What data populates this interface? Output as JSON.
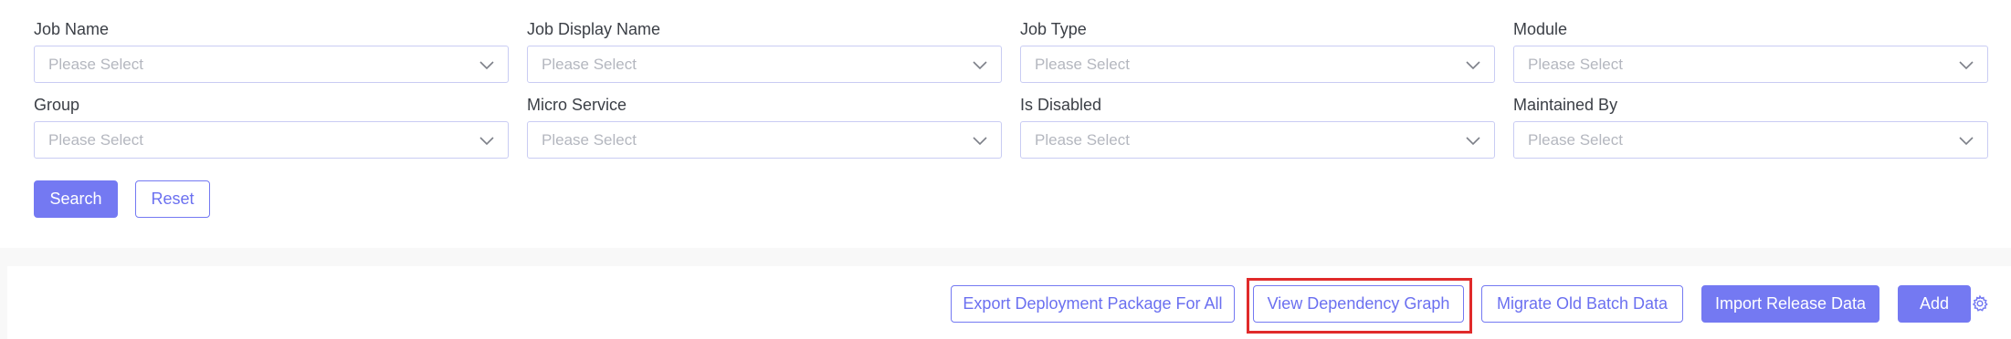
{
  "filters": {
    "row1": [
      {
        "label": "Job Name",
        "placeholder": "Please Select"
      },
      {
        "label": "Job Display Name",
        "placeholder": "Please Select"
      },
      {
        "label": "Job Type",
        "placeholder": "Please Select"
      },
      {
        "label": "Module",
        "placeholder": "Please Select"
      }
    ],
    "row2": [
      {
        "label": "Group",
        "placeholder": "Please Select"
      },
      {
        "label": "Micro Service",
        "placeholder": "Please Select"
      },
      {
        "label": "Is Disabled",
        "placeholder": "Please Select"
      },
      {
        "label": "Maintained By",
        "placeholder": "Please Select"
      }
    ]
  },
  "form_actions": {
    "search_label": "Search",
    "reset_label": "Reset"
  },
  "toolbar": {
    "export_label": "Export Deployment Package For All",
    "view_graph_label": "View Dependency Graph",
    "migrate_label": "Migrate Old Batch Data",
    "import_label": "Import Release Data",
    "add_label": "Add",
    "settings_icon": "gear-icon"
  },
  "colors": {
    "accent": "#7479f2",
    "highlight": "#e02a2a"
  }
}
